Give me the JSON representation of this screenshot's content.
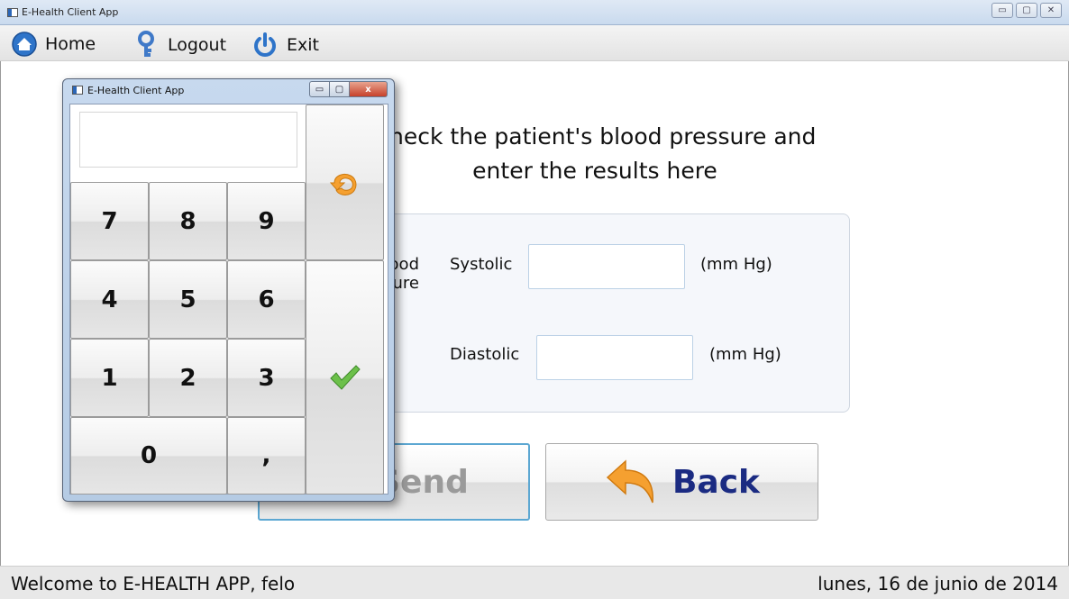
{
  "window": {
    "title": "E-Health Client App",
    "controls": {
      "minimize": "▭",
      "maximize": "▢",
      "close": "✕"
    }
  },
  "toolbar": {
    "items": [
      {
        "label": "Home",
        "icon": "home-icon"
      },
      {
        "label": "Logout",
        "icon": "key-icon"
      },
      {
        "label": "Exit",
        "icon": "power-icon"
      }
    ]
  },
  "main": {
    "instruction_line1": "Check the patient's blood pressure and",
    "instruction_line2": "enter the results here",
    "panel": {
      "section_label": "Blood pressure",
      "systolic_label": "Systolic",
      "systolic_value": "",
      "systolic_unit": "(mm Hg)",
      "diastolic_label": "Diastolic",
      "diastolic_value": "",
      "diastolic_unit": "(mm Hg)"
    },
    "send_label": "Send",
    "back_label": "Back"
  },
  "status": {
    "welcome": "Welcome to E-HEALTH APP, felo",
    "date": "lunes, 16 de junio de 2014"
  },
  "keypad": {
    "title": "E-Health Client App",
    "display_value": "",
    "keys": {
      "k7": "7",
      "k8": "8",
      "k9": "9",
      "k4": "4",
      "k5": "5",
      "k6": "6",
      "k1": "1",
      "k2": "2",
      "k3": "3",
      "k0": "0",
      "comma": ","
    },
    "controls": {
      "minimize": "▭",
      "maximize": "▢",
      "close": "x"
    }
  },
  "colors": {
    "accent_blue": "#5ca7d2",
    "back_text": "#1b2b82",
    "ok_green": "#6cc04a",
    "arrow_orange": "#f5a030"
  }
}
